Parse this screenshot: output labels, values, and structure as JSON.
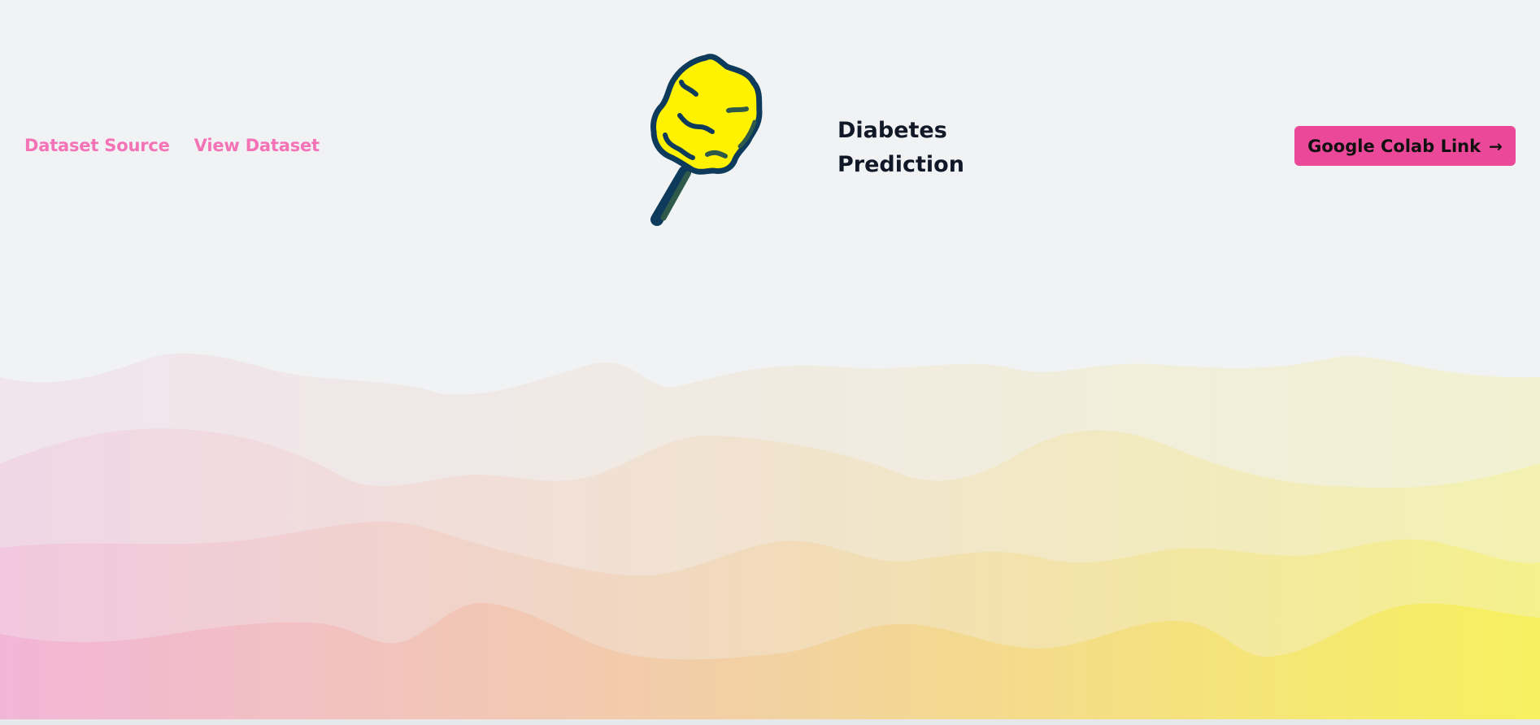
{
  "nav": {
    "links": [
      {
        "label": "Dataset Source"
      },
      {
        "label": "View Dataset"
      }
    ]
  },
  "brand": {
    "title_line1": "Diabetes",
    "title_line2": "Prediction",
    "logo_icon": "cotton-candy-icon"
  },
  "cta": {
    "label": "Google Colab Link",
    "icon": "arrow-right-icon"
  },
  "colors": {
    "accent": "#ec4899",
    "link": "#f472b6",
    "title": "#111827",
    "background": "#f0f2f4",
    "candy_fill": "#fff200",
    "candy_outline": "#0e3b5c",
    "wave_start": "#f2a6cf",
    "wave_end": "#f9f03a"
  }
}
